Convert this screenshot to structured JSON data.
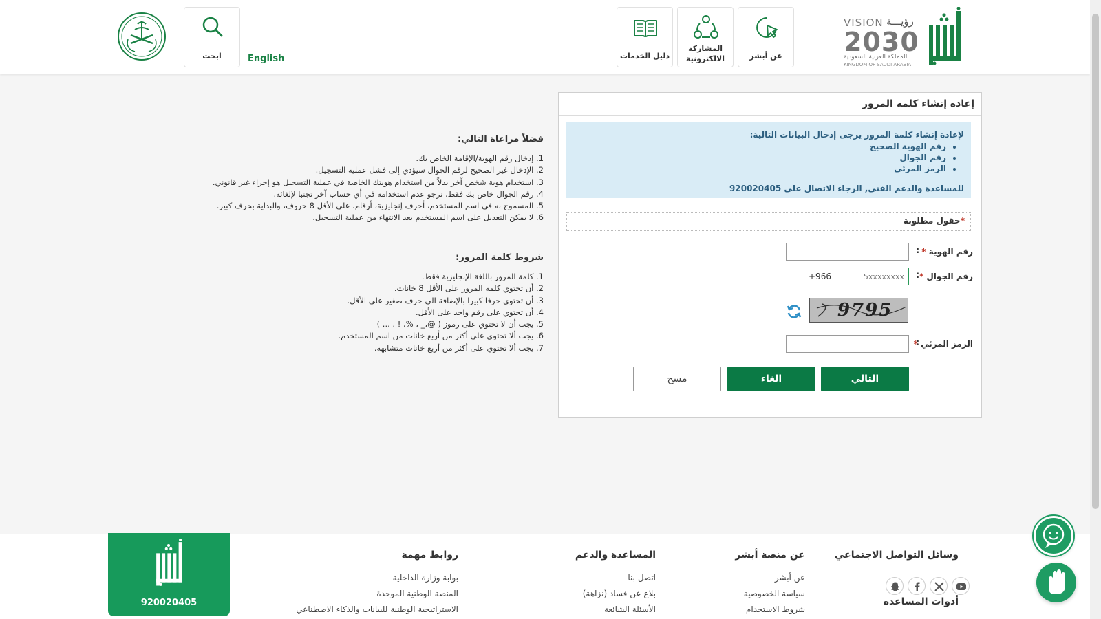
{
  "header": {
    "nav": [
      {
        "label": "عن أبشر",
        "icon": "cursor-circle-icon"
      },
      {
        "label": "المشاركة الالكترونية",
        "icon": "network-share-icon"
      },
      {
        "label": "دليل الخدمات",
        "icon": "book-icon"
      }
    ],
    "search_label": "ابحث",
    "english_link": "English",
    "vision": {
      "title": "VISION",
      "year": "2030",
      "arabic": "رؤيـــة",
      "sub_ar": "المملكة العربية السعودية",
      "sub_en": "KINGDOM OF SAUDI ARABIA"
    }
  },
  "form": {
    "title": "إعادة إنشاء كلمة المرور",
    "info": {
      "intro": "لإعادة إنشاء كلمة المرور يرجى إدخال البيانات التالية:",
      "items": [
        "رقم الهوية الصحيح",
        "رقم الجوال",
        "الرمز المرئي"
      ],
      "support": "للمساعدة والدعم الفني, الرجاء الاتصال على 920020405"
    },
    "required_note": "حقول مطلوبة",
    "required_star": "*",
    "fields": {
      "id_label": "رقم الهوية",
      "id_value": "",
      "mobile_label": "رقم الجوال",
      "mobile_placeholder": "5xxxxxxxx",
      "mobile_prefix": "+966",
      "captcha_text": "9795",
      "visual_code_label": "الرمز المرئي",
      "visual_code_value": ""
    },
    "buttons": {
      "next": "التالي",
      "cancel": "الغاء",
      "clear": "مسح"
    }
  },
  "notes": {
    "general_title": "فضلاً مراعاة التالي:",
    "general_items": [
      "1. إدخال رقم الهوية/الإقامة الخاص بك.",
      "2. الإدخال غير الصحيح لرقم الجوال سيؤدي إلى فشل عملية التسجيل.",
      "3. استخدام هوية شخص آخر بدلاً من استخدام هويتك الخاصة في عملية التسجيل هو إجراء غير قانوني.",
      "4. رقم الجوال خاص بك فقط، نرجو عدم استخدامه في أي حساب آخر تجنبا لإلغائه.",
      "5. المسموح به في اسم المستخدم، أحرف إنجليزية، أرقام، على الأقل 8 حروف، والبداية بحرف كبير.",
      "6. لا يمكن التعديل على اسم المستخدم بعد الانتهاء من عملية التسجيل."
    ],
    "password_title": "شروط كلمة المرور:",
    "password_items": [
      "1. كلمة المرور باللغة الإنجليزية فقط.",
      "2. أن تحتوي كلمة المرور على الأقل 8 خانات.",
      "3. أن تحتوي حرفا كبيرا بالإضافة الى حرف صغير على الأقل.",
      "4. أن تحتوي على رقم واحد على الأقل.",
      "5. يجب أن لا تحتوي على رموز ( @،_ ، %، ! ، ... )",
      "6. يجب ألا تحتوي على أكثر من أربع خانات من اسم المستخدم.",
      "7. يجب ألا تحتوي على أكثر من أربع خانات متشابهة."
    ]
  },
  "footer": {
    "social_title": "وسائل التواصل الاجتماعي",
    "tools_title": "أدوات المساعدة",
    "absher": {
      "title": "عن منصة أبشر",
      "links": [
        "عن أبشر",
        "سياسة الخصوصية",
        "شروط الاستخدام"
      ]
    },
    "support": {
      "title": "المساعدة والدعم",
      "links": [
        "اتصل بنا",
        "بلاغ عن فساد (نزاهة)",
        "الأسئلة الشائعة"
      ]
    },
    "important": {
      "title": "روابط مهمة",
      "links": [
        "بوابة وزارة الداخلية",
        "المنصة الوطنية الموحدة",
        "الاستراتيجية الوطنية للبيانات والذكاء الاصطناعي"
      ]
    },
    "phone": "920020405",
    "social_icons": [
      "youtube-icon",
      "x-icon",
      "facebook-icon",
      "snapchat-icon"
    ]
  },
  "colors": {
    "brand_green": "#0b7a45",
    "footer_green": "#179a5b",
    "info_bg": "#d9ecf6"
  }
}
